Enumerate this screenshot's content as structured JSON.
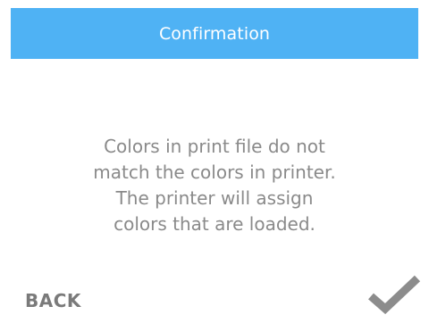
{
  "dialog": {
    "title": "Confirmation",
    "message_lines": [
      "Colors in print file do not",
      "match the colors in printer.",
      "The printer will assign",
      "colors that are loaded."
    ]
  },
  "actions": {
    "back_label": "BACK",
    "confirm_icon": "checkmark-icon"
  },
  "colors": {
    "title_bar": "#4fb2f4",
    "title_text": "#ffffff",
    "message_text": "#8a8a8a",
    "back_text": "#7a7a7a",
    "checkmark": "#8c8c8c"
  }
}
